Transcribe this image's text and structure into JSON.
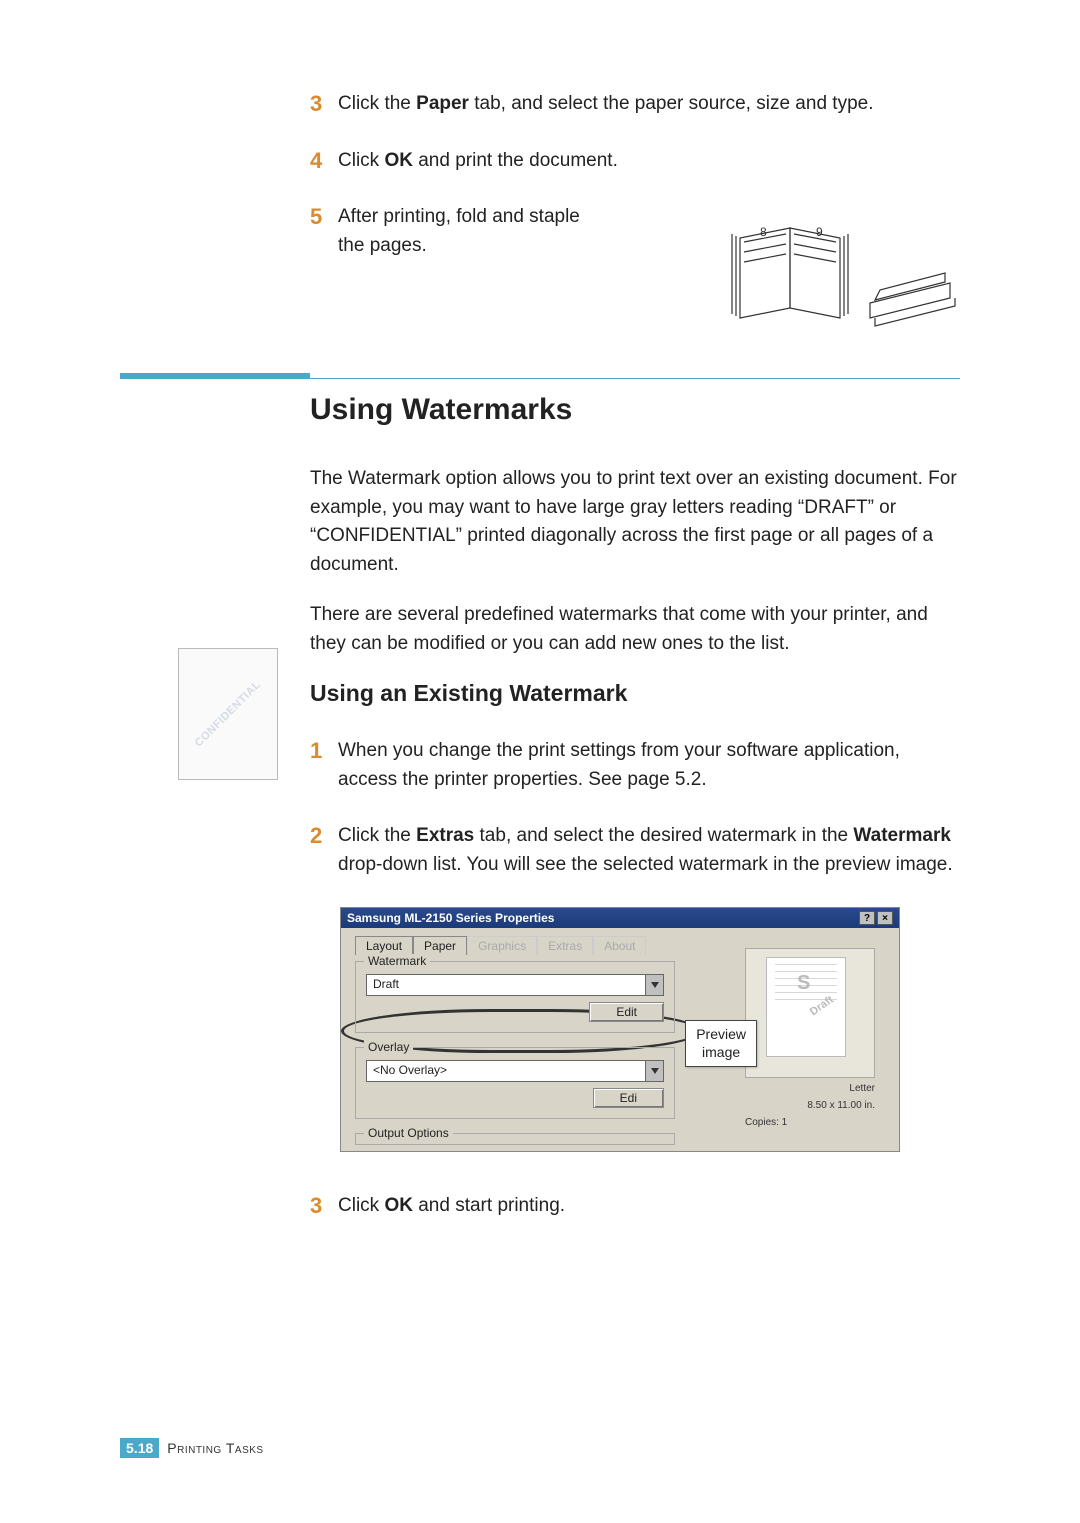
{
  "steps_top": {
    "s3": {
      "num": "3",
      "prefix": "Click the ",
      "bold": "Paper",
      "suffix": " tab, and select the paper source, size and type."
    },
    "s4": {
      "num": "4",
      "prefix": "Click ",
      "bold": "OK",
      "suffix": " and print the document."
    },
    "s5": {
      "num": "5",
      "text": "After printing, fold and staple the pages."
    }
  },
  "booklet": {
    "left_num": "8",
    "right_num": "9"
  },
  "section_heading": "Using Watermarks",
  "sidebar_thumb": {
    "diag": "CONFIDENTIAL"
  },
  "para1": "The Watermark option allows you to print text over an existing document. For example, you may want to have large gray letters reading “DRAFT” or “CONFIDENTIAL” printed diagonally across the first page or all pages of a document.",
  "para2": "There are several predefined watermarks that come with your printer, and they can be modified or you can add new ones to the list.",
  "subheading": "Using an Existing Watermark",
  "steps_mid": {
    "s1": {
      "num": "1",
      "text": "When you change the print settings from your software application, access the printer properties. See page 5.2."
    },
    "s2": {
      "num": "2",
      "prefix": "Click the ",
      "bold1": "Extras",
      "mid": " tab, and select the desired watermark in the ",
      "bold2": "Watermark",
      "suffix": " drop-down list. You will see the selected watermark in the preview image."
    },
    "s3": {
      "num": "3",
      "prefix": "Click ",
      "bold": "OK",
      "suffix": " and start printing."
    }
  },
  "screenshot": {
    "title": "Samsung ML-2150 Series Properties",
    "help": "?",
    "close": "×",
    "tabs": {
      "layout": "Layout",
      "paper": "Paper",
      "graphics": "Graphics",
      "extras": "Extras",
      "about": "About"
    },
    "watermark_label": "Watermark",
    "watermark_value": "Draft",
    "edit_btn": "Edit",
    "overlay_label": "Overlay",
    "overlay_value": "<No Overlay>",
    "edit_btn2": "Edi",
    "output_label": "Output Options",
    "preview_callout": "Preview\nimage",
    "preview_s": "S",
    "preview_draft": "Draft",
    "paper_size": "Letter",
    "paper_dims": "8.50 x 11.00 in.",
    "copies": "Copies: 1"
  },
  "footer": {
    "chapter": "5.",
    "page": "18",
    "title": "Printing Tasks"
  }
}
